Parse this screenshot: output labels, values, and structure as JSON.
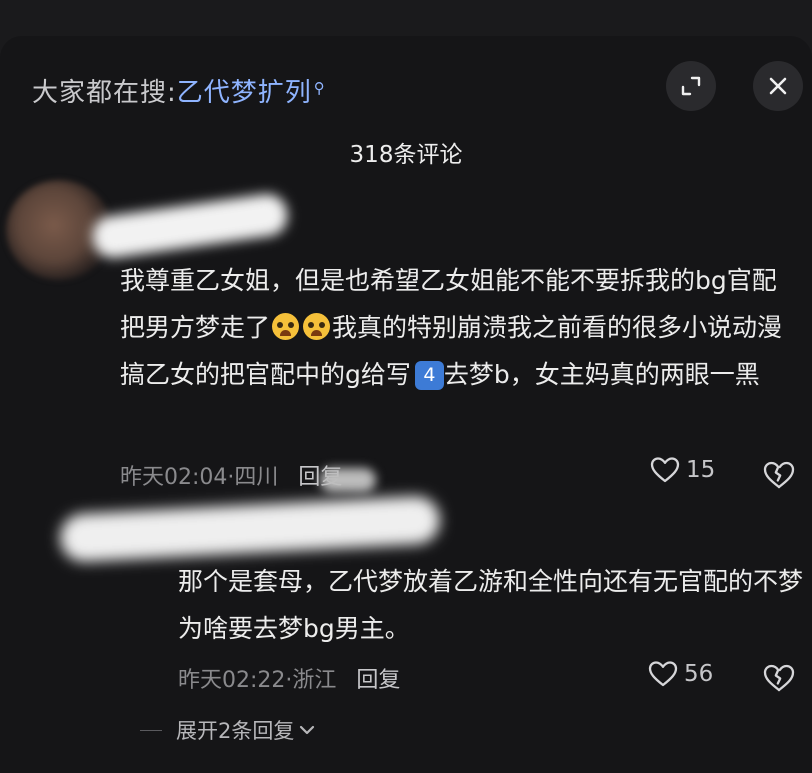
{
  "search": {
    "prefix": "大家都在搜:",
    "keyword": "乙代梦扩列",
    "icon": "search-icon"
  },
  "header": {
    "comment_count": "318条评论",
    "expand_icon": "expand-icon",
    "close_icon": "close-icon"
  },
  "comments": [
    {
      "text_part1": "我尊重乙女姐，但是也希望乙女姐能不能不要拆我的bg官配把男方梦走了",
      "emoji": "loudly-crying-face",
      "text_part2": "我真的特别崩溃我之前看的很多小说动漫搞乙女的把官配中的g给写",
      "keycap": "4",
      "text_part3": "去梦b，女主妈真的两眼一黑",
      "time": "昨天02:04",
      "location": "四川",
      "reply_label": "回复",
      "likes": "15"
    },
    {
      "text": "那个是套母，乙代梦放着乙游和全性向还有无官配的不梦为啥要去梦bg男主。",
      "time": "昨天02:22",
      "location": "浙江",
      "reply_label": "回复",
      "likes": "56"
    }
  ],
  "expand_replies": {
    "label": "展开2条回复",
    "icon": "chevron-down-icon"
  },
  "colors": {
    "background": "#151517",
    "accent": "#8fb4ff",
    "muted": "#8a8a8d"
  }
}
